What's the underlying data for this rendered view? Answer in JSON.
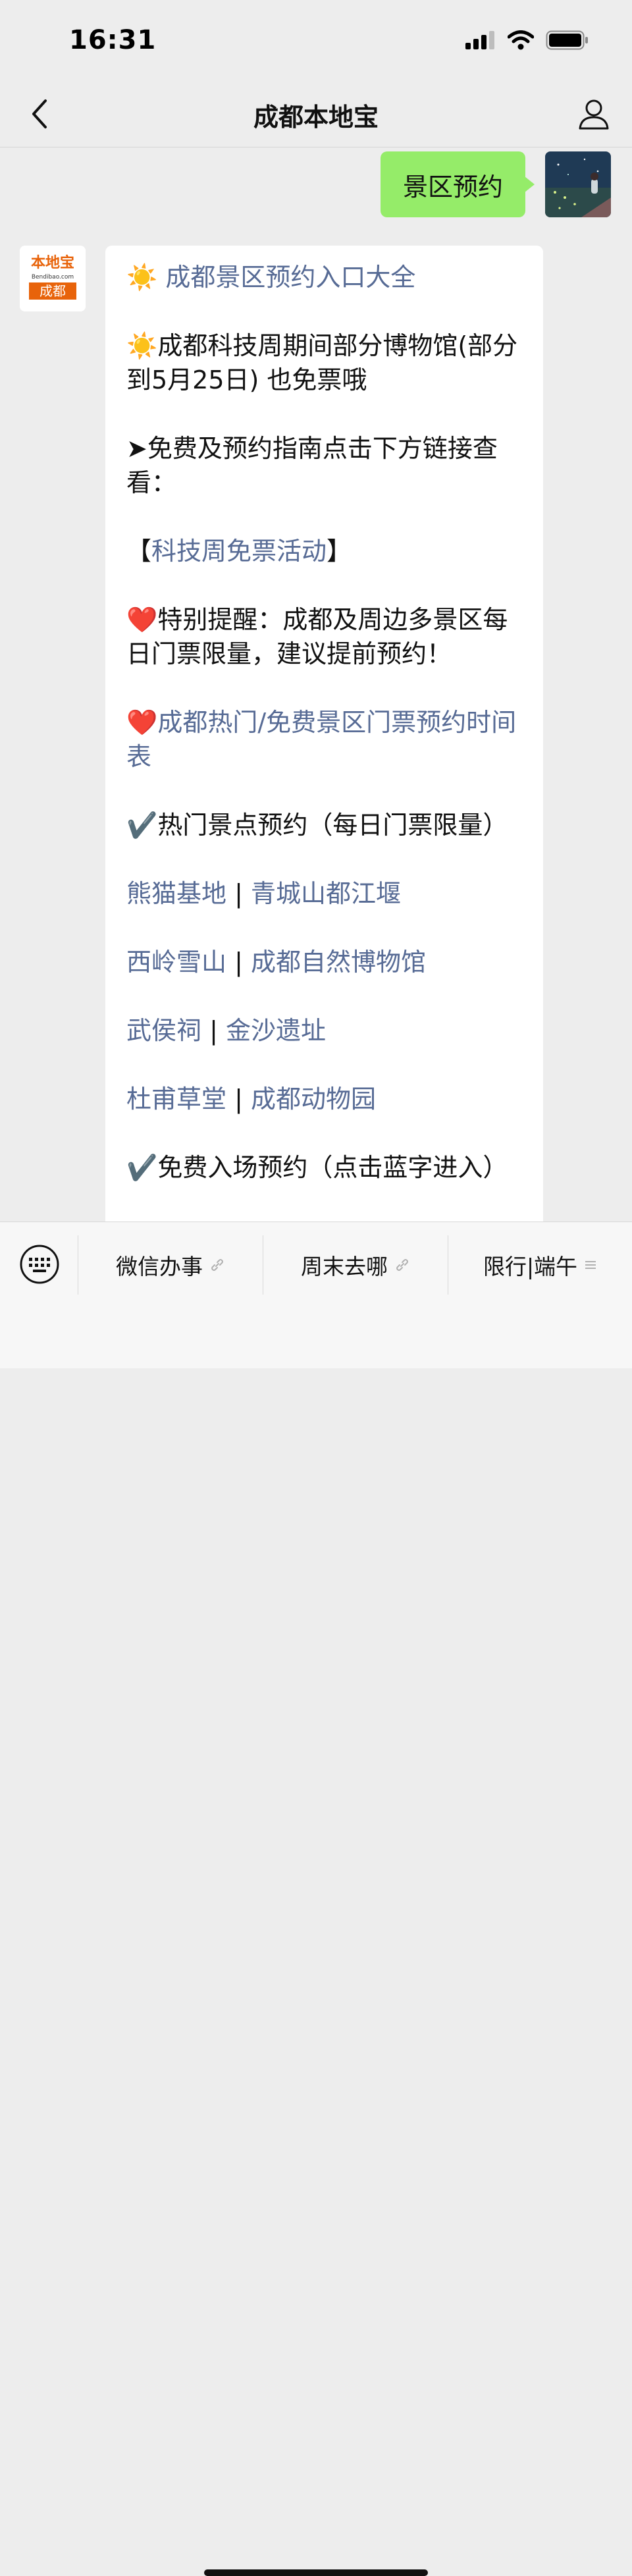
{
  "status": {
    "time": "16:31"
  },
  "nav": {
    "title": "成都本地宝"
  },
  "user_message": {
    "text": "景区预约"
  },
  "bot": {
    "avatar_logo_top": "本地宝",
    "avatar_logo_url": "Bendibao.com",
    "avatar_logo_city": "成都",
    "title_emoji": "☀️",
    "title": "成都景区预约入口大全",
    "p1_emoji": "☀️",
    "p1_text": "成都科技周期间部分博物馆(部分到5月25日) 也免票哦",
    "p2_text": "➤免费及预约指南点击下方链接查看：",
    "p3_open": "【",
    "p3_link": "科技周免票活动",
    "p3_close": "】",
    "p4_emoji": "❤️",
    "p4_text": "特别提醒：成都及周边多景区每日门票限量，建议提前预约！",
    "p5_emoji": "❤️",
    "p5_link": "成都热门/免费景区门票预约时间表",
    "section1": "✔️热门景点预约（每日门票限量）",
    "links": [
      {
        "a": "熊猫基地",
        "b": "青城山都江堰"
      },
      {
        "a": "西岭雪山",
        "b": "成都自然博物馆"
      },
      {
        "a": "武侯祠",
        "b": "金沙遗址"
      },
      {
        "a": "杜甫草堂",
        "b": "成都动物园"
      }
    ],
    "separator": "|",
    "section2": "✔️免费入场预约（点击蓝字进入）"
  },
  "menu": {
    "items": [
      {
        "label": "微信办事",
        "icon": "link-icon"
      },
      {
        "label": "周末去哪",
        "icon": "link-icon"
      },
      {
        "label": "限行|端午",
        "icon": "menu-lines-icon"
      }
    ]
  },
  "colors": {
    "link": "#576b95",
    "user_bubble": "#95ec69",
    "background": "#ededed"
  }
}
